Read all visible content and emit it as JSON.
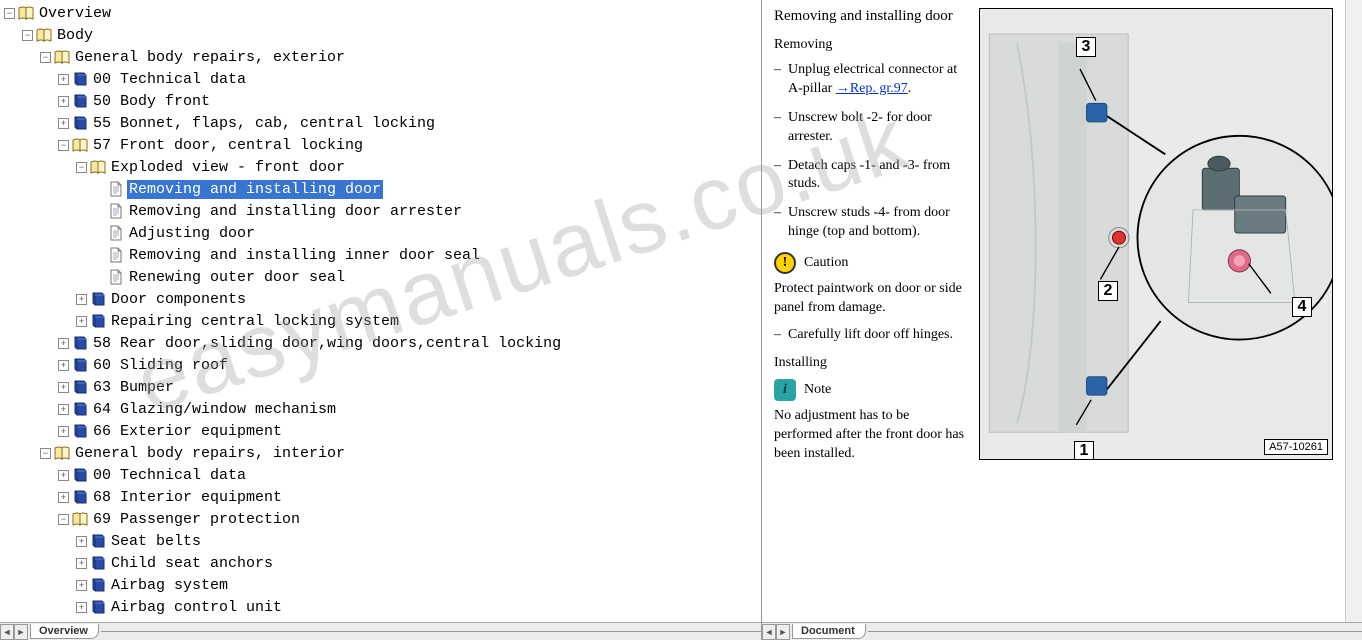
{
  "watermark": "easymanuals.co.uk",
  "left": {
    "tab": "Overview",
    "tree": [
      {
        "depth": 0,
        "toggle": "-",
        "icon": "book-open",
        "label": "Overview"
      },
      {
        "depth": 1,
        "toggle": "-",
        "icon": "book-open",
        "label": "Body"
      },
      {
        "depth": 2,
        "toggle": "-",
        "icon": "book-open",
        "label": "General body repairs, exterior"
      },
      {
        "depth": 3,
        "toggle": "+",
        "icon": "book",
        "label": "00 Technical data"
      },
      {
        "depth": 3,
        "toggle": "+",
        "icon": "book",
        "label": "50 Body front"
      },
      {
        "depth": 3,
        "toggle": "+",
        "icon": "book",
        "label": "55 Bonnet, flaps, cab, central locking"
      },
      {
        "depth": 3,
        "toggle": "-",
        "icon": "book-open",
        "label": "57 Front door, central locking"
      },
      {
        "depth": 4,
        "toggle": "-",
        "icon": "book-open",
        "label": "Exploded view - front door"
      },
      {
        "depth": 5,
        "toggle": "",
        "icon": "page",
        "label": "Removing and installing door",
        "selected": true
      },
      {
        "depth": 5,
        "toggle": "",
        "icon": "page",
        "label": "Removing and installing door arrester"
      },
      {
        "depth": 5,
        "toggle": "",
        "icon": "page",
        "label": "Adjusting door"
      },
      {
        "depth": 5,
        "toggle": "",
        "icon": "page",
        "label": "Removing and installing inner door seal"
      },
      {
        "depth": 5,
        "toggle": "",
        "icon": "page",
        "label": "Renewing outer door seal"
      },
      {
        "depth": 4,
        "toggle": "+",
        "icon": "book",
        "label": "Door components"
      },
      {
        "depth": 4,
        "toggle": "+",
        "icon": "book",
        "label": "Repairing central locking system"
      },
      {
        "depth": 3,
        "toggle": "+",
        "icon": "book",
        "label": "58 Rear door,sliding door,wing doors,central locking"
      },
      {
        "depth": 3,
        "toggle": "+",
        "icon": "book",
        "label": "60 Sliding roof"
      },
      {
        "depth": 3,
        "toggle": "+",
        "icon": "book",
        "label": "63 Bumper"
      },
      {
        "depth": 3,
        "toggle": "+",
        "icon": "book",
        "label": "64 Glazing/window mechanism"
      },
      {
        "depth": 3,
        "toggle": "+",
        "icon": "book",
        "label": "66 Exterior equipment"
      },
      {
        "depth": 2,
        "toggle": "-",
        "icon": "book-open",
        "label": "General body repairs, interior"
      },
      {
        "depth": 3,
        "toggle": "+",
        "icon": "book",
        "label": "00 Technical data"
      },
      {
        "depth": 3,
        "toggle": "+",
        "icon": "book",
        "label": "68 Interior equipment"
      },
      {
        "depth": 3,
        "toggle": "-",
        "icon": "book-open",
        "label": "69 Passenger protection"
      },
      {
        "depth": 4,
        "toggle": "+",
        "icon": "book",
        "label": "Seat belts"
      },
      {
        "depth": 4,
        "toggle": "+",
        "icon": "book",
        "label": "Child seat anchors"
      },
      {
        "depth": 4,
        "toggle": "+",
        "icon": "book",
        "label": "Airbag system"
      },
      {
        "depth": 4,
        "toggle": "+",
        "icon": "book",
        "label": "Airbag control unit"
      }
    ]
  },
  "right": {
    "tab": "Document",
    "title": "Removing and installing door",
    "sub1": "Removing",
    "steps1": [
      {
        "text": "Unplug electrical connector at A-pillar ",
        "link": "→Rep. gr.97",
        "after": "."
      },
      {
        "text": "Unscrew bolt -2- for door arrester."
      },
      {
        "text": "Detach caps -1- and -3- from studs."
      },
      {
        "text": "Unscrew studs -4- from door hinge (top and bottom)."
      }
    ],
    "caution_label": "Caution",
    "caution_body": "Protect paintwork on door or side panel from damage.",
    "steps2": [
      {
        "text": "Carefully lift door off hinges."
      }
    ],
    "sub2": "Installing",
    "note_label": "Note",
    "note_body": "No adjustment has to be performed after the front door has been installed.",
    "figure_id": "A57-10261",
    "figure_labels": {
      "1": "1",
      "2": "2",
      "3": "3",
      "4": "4"
    }
  }
}
